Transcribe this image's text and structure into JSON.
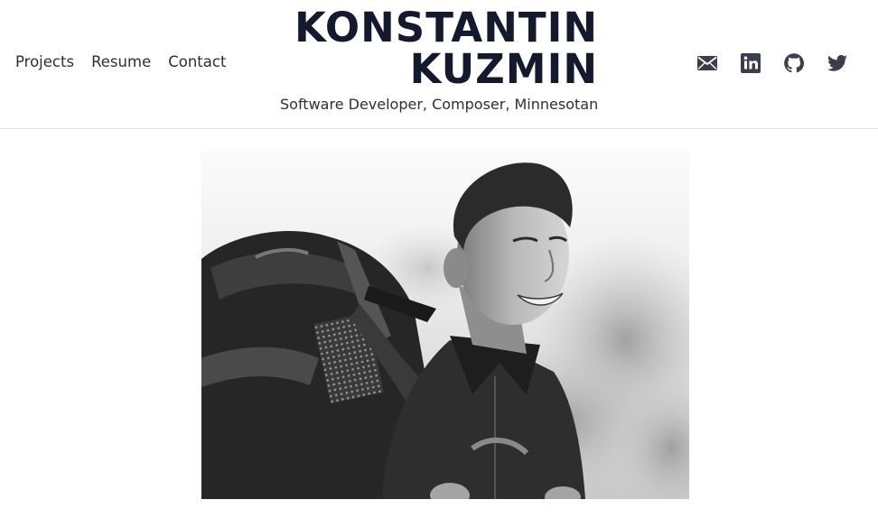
{
  "header": {
    "brand_line1": "KONSTANTIN",
    "brand_line2": "KUZMIN",
    "tagline": "Software Developer, Composer, Minnesotan"
  },
  "nav": {
    "items": [
      {
        "label": "Projects"
      },
      {
        "label": "Resume"
      },
      {
        "label": "Contact"
      }
    ]
  },
  "social": {
    "icons": [
      "envelope-icon",
      "linkedin-icon",
      "github-icon",
      "twitter-icon"
    ],
    "color": "#3b3f4c"
  },
  "photo": {
    "style": "grayscale portrait of a smiling hiker with a backpack"
  }
}
